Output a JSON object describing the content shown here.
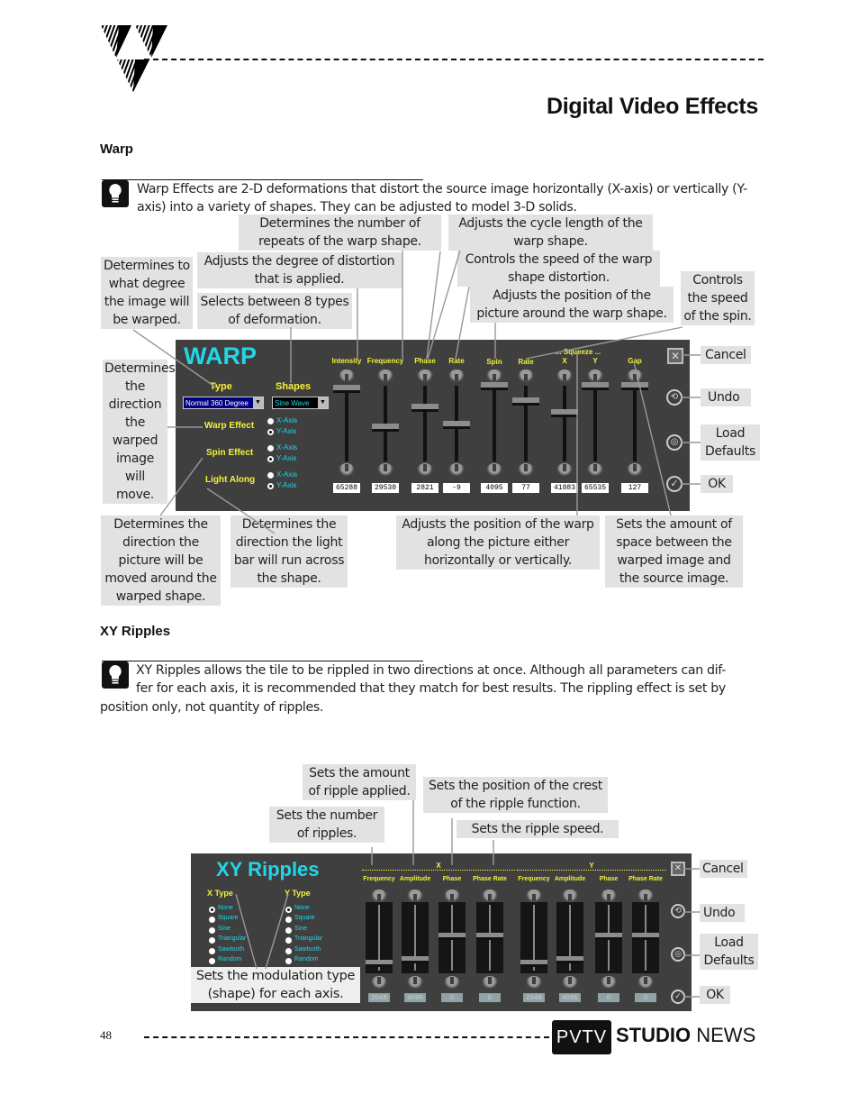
{
  "header": {
    "logo": "pvtv-triangle-logo",
    "title": "Digital Video Effects"
  },
  "warp_section": {
    "heading": "Warp",
    "tip_icon": "lightbulb-icon",
    "intro": "Warp Effects are 2-D deformations that distort the source image horizontally (X-axis) or vertically (Y-axis) into a variety of shapes.  They can be adjusted to model 3-D solids.",
    "callouts": {
      "frequency": "Determines the number of repeats of the warp shape.",
      "phase": "Adjusts the cycle length of the warp shape.",
      "intensity_type": "Determines to what degree the image will be warped.",
      "intensity": "Adjusts the degree of distortion that is applied.",
      "rate": "Controls the speed of the warp shape distortion.",
      "shapes": "Selects between 8 types of deformation.",
      "spin": "Adjusts the position of the picture around the warp shape.",
      "spin_rate": "Controls the speed of the spin.",
      "warp_effect": "Determines the direction the warped image will move.",
      "spin_effect": "Determines the direction the picture will be moved around the warped shape.",
      "light_along": "Determines the direction the light bar will run across the shape.",
      "squeeze": "Adjusts the position of the warp along the picture either horizontally or vertically.",
      "gap": "Sets the amount of space between the warped image and the source image."
    },
    "panel": {
      "title": "WARP",
      "type_label": "Type",
      "type_value": "Normal 360 Degree",
      "shapes_label": "Shapes",
      "shapes_value": "Sine Wave",
      "radio_groups": [
        {
          "label": "Warp Effect",
          "options": [
            "X-Axis",
            "Y-Axis"
          ],
          "selected": "Y-Axis"
        },
        {
          "label": "Spin Effect",
          "options": [
            "X-Axis",
            "Y-Axis"
          ],
          "selected": "Y-Axis"
        },
        {
          "label": "Light Along",
          "options": [
            "X-Axis",
            "Y-Axis"
          ],
          "selected": "Y-Axis"
        }
      ],
      "squeeze_label": "... Squeeze ...",
      "sliders": [
        {
          "label": "Intensity",
          "value": "65288",
          "position": 0.97
        },
        {
          "label": "Frequency",
          "value": "29530",
          "position": 0.45
        },
        {
          "label": "Phase",
          "value": "2821",
          "position": 0.72
        },
        {
          "label": "Rate",
          "value": "-9",
          "position": 0.49
        },
        {
          "label": "Spin",
          "value": "4095",
          "position": 1.0
        },
        {
          "label": "Rate",
          "value": "77",
          "position": 0.8
        },
        {
          "label": "X",
          "value": "41883",
          "position": 0.64
        },
        {
          "label": "Y",
          "value": "65535",
          "position": 1.0
        },
        {
          "label": "Gap",
          "value": "127",
          "position": 1.0
        }
      ],
      "buttons": [
        {
          "icon": "cancel-icon",
          "label": "Cancel"
        },
        {
          "icon": "undo-icon",
          "label": "Undo"
        },
        {
          "icon": "load-defaults-icon",
          "label": "Load Defaults"
        },
        {
          "icon": "ok-check-icon",
          "label": "OK"
        }
      ]
    }
  },
  "ripples_section": {
    "heading": "XY Ripples",
    "tip_icon": "lightbulb-icon",
    "intro_line1": "XY Ripples allows the tile to be rippled in two directions at once.  Although all parameters can dif-",
    "intro_line2": "fer for each axis, it is recommended that they match for best results.  The rippling effect is set by",
    "intro_line3": "position only, not quantity of ripples.",
    "callouts": {
      "amplitude": "Sets the amount of ripple applied.",
      "phase": "Sets the position of the crest of the ripple function.",
      "frequency": "Sets the number of ripples.",
      "phase_rate": "Sets the ripple speed.",
      "type": "Sets the modulation type (shape) for each axis."
    },
    "panel": {
      "title": "XY Ripples",
      "x_type_label": "X Type",
      "y_type_label": "Y Type",
      "type_options": [
        "None",
        "Square",
        "Sine",
        "Triangular",
        "Sawtooth",
        "Random"
      ],
      "x_type_selected": "None",
      "y_type_selected": "None",
      "x_group_label": "X",
      "y_group_label": "Y",
      "sliders": [
        {
          "label": "Frequency",
          "value": "2048",
          "position": 0.05
        },
        {
          "label": "Amplitude",
          "value": "4096",
          "position": 0.1
        },
        {
          "label": "Phase",
          "value": "0",
          "position": 0.5
        },
        {
          "label": "Phase Rate",
          "value": "0",
          "position": 0.5
        },
        {
          "label": "Frequency",
          "value": "2048",
          "position": 0.05
        },
        {
          "label": "Amplitude",
          "value": "4096",
          "position": 0.1
        },
        {
          "label": "Phase",
          "value": "0",
          "position": 0.5
        },
        {
          "label": "Phase Rate",
          "value": "0",
          "position": 0.5
        }
      ],
      "buttons": [
        {
          "icon": "cancel-icon",
          "label": "Cancel"
        },
        {
          "icon": "undo-icon",
          "label": "Undo"
        },
        {
          "icon": "load-defaults-icon",
          "label": "Load Defaults"
        },
        {
          "icon": "ok-check-icon",
          "label": "OK"
        }
      ]
    }
  },
  "footer": {
    "page_number": "48",
    "brand_logo": "PVTV",
    "brand_bold": "STUDIO",
    "brand_light": " NEWS"
  }
}
